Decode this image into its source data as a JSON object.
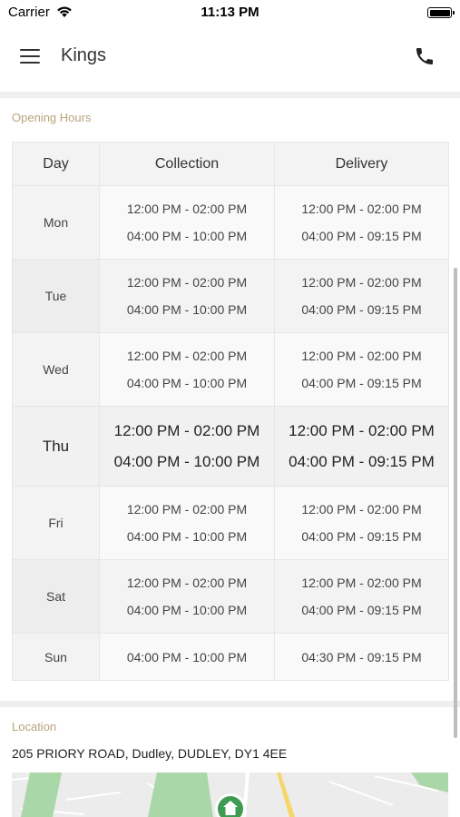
{
  "status_bar": {
    "carrier": "Carrier",
    "time": "11:13 PM"
  },
  "header": {
    "title": "Kings"
  },
  "opening_hours": {
    "section_title": "Opening Hours",
    "columns": [
      "Day",
      "Collection",
      "Delivery"
    ],
    "rows": [
      {
        "day": "Mon",
        "collection": [
          "12:00 PM - 02:00 PM",
          "04:00 PM - 10:00 PM"
        ],
        "delivery": [
          "12:00 PM - 02:00 PM",
          "04:00 PM - 09:15 PM"
        ]
      },
      {
        "day": "Tue",
        "collection": [
          "12:00 PM - 02:00 PM",
          "04:00 PM - 10:00 PM"
        ],
        "delivery": [
          "12:00 PM - 02:00 PM",
          "04:00 PM - 09:15 PM"
        ]
      },
      {
        "day": "Wed",
        "collection": [
          "12:00 PM - 02:00 PM",
          "04:00 PM - 10:00 PM"
        ],
        "delivery": [
          "12:00 PM - 02:00 PM",
          "04:00 PM - 09:15 PM"
        ]
      },
      {
        "day": "Thu",
        "collection": [
          "12:00 PM - 02:00 PM",
          "04:00 PM - 10:00 PM"
        ],
        "delivery": [
          "12:00 PM - 02:00 PM",
          "04:00 PM - 09:15 PM"
        ]
      },
      {
        "day": "Fri",
        "collection": [
          "12:00 PM - 02:00 PM",
          "04:00 PM - 10:00 PM"
        ],
        "delivery": [
          "12:00 PM - 02:00 PM",
          "04:00 PM - 09:15 PM"
        ]
      },
      {
        "day": "Sat",
        "collection": [
          "12:00 PM - 02:00 PM",
          "04:00 PM - 10:00 PM"
        ],
        "delivery": [
          "12:00 PM - 02:00 PM",
          "04:00 PM - 09:15 PM"
        ]
      },
      {
        "day": "Sun",
        "collection": [
          "04:00 PM - 10:00 PM"
        ],
        "delivery": [
          "04:30 PM - 09:15 PM"
        ]
      }
    ]
  },
  "location": {
    "section_title": "Location",
    "address": "205 PRIORY ROAD, Dudley, DUDLEY, DY1 4EE"
  },
  "icons": {
    "wifi": "wifi-icon",
    "battery": "battery-icon",
    "menu": "hamburger-menu-icon",
    "phone": "phone-icon",
    "map_pin": "home-pin-icon"
  },
  "colors": {
    "section_label": "#b7a37c",
    "map_park": "#a9d7a7",
    "map_road": "#f6d66a",
    "map_pin": "#3f9a52"
  }
}
